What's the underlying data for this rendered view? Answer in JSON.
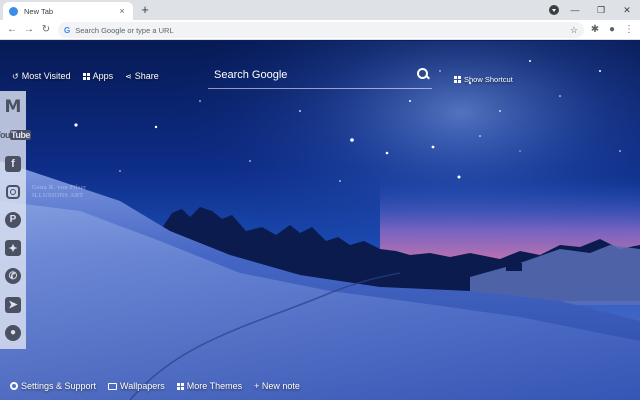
{
  "browser": {
    "tab_title": "New Tab",
    "tab_close": "×",
    "new_tab": "+",
    "address_placeholder": "Search Google or type a URL",
    "back": "←",
    "forward": "→",
    "reload": "↻",
    "star": "☆",
    "extensions": "✱",
    "profile": "●",
    "menu": "⋮",
    "minimize": "—",
    "restore": "❐",
    "close": "✕",
    "google_letter": "G"
  },
  "top_links": {
    "most_visited": "Most Visited",
    "most_visited_icon": "↺",
    "apps": "Apps",
    "share": "Share",
    "share_icon": "⋖"
  },
  "search": {
    "placeholder": "Search Google"
  },
  "show_shortcut": "Show Shortcut",
  "social": {
    "gmail": "M",
    "youtube_you": "You",
    "youtube_tube": "Tube",
    "facebook": "f",
    "pinterest": "P",
    "twitter": "✦",
    "whatsapp": "✆",
    "telegram": "➤",
    "reddit": "●"
  },
  "watermark": {
    "line1": "Gena R. von Filser",
    "line2": "ILLUSIONS ART"
  },
  "bottom": {
    "settings": "Settings & Support",
    "wallpapers": "Wallpapers",
    "more_themes": "More Themes",
    "new_note": "+ New note"
  },
  "colors": {
    "chrome_tabstrip": "#dee1e6",
    "sky_top": "#071a55",
    "sky_horizon": "#e56aa0",
    "snow": "#5978d0"
  }
}
